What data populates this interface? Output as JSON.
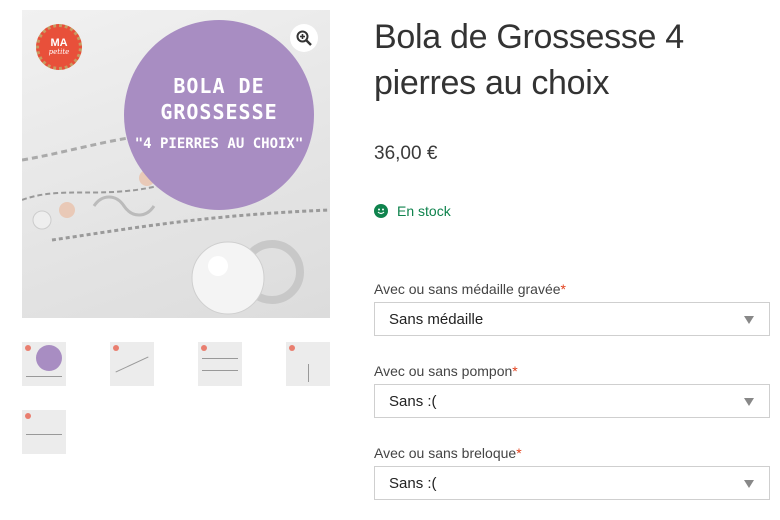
{
  "product": {
    "title": "Bola de Grossesse 4 pierres au choix",
    "price": "36,00 €",
    "stock": "En stock"
  },
  "gallery": {
    "logo_top": "MA",
    "logo_bottom": "petite",
    "banner_line1": "BOLA DE",
    "banner_line2": "GROSSESSE",
    "banner_line3": "\"4 PIERRES AU CHOIX\"",
    "zoom_icon": "magnifier-plus-icon"
  },
  "options": [
    {
      "label": "Avec ou sans médaille gravée",
      "required": "*",
      "value": "Sans médaille"
    },
    {
      "label": "Avec ou sans pompon",
      "required": "*",
      "value": "Sans :("
    },
    {
      "label": "Avec ou sans breloque",
      "required": "*",
      "value": "Sans :("
    }
  ],
  "colors": {
    "accent_purple": "#a88dc2",
    "stock_green": "#0f834d",
    "required_red": "#e2401c"
  }
}
